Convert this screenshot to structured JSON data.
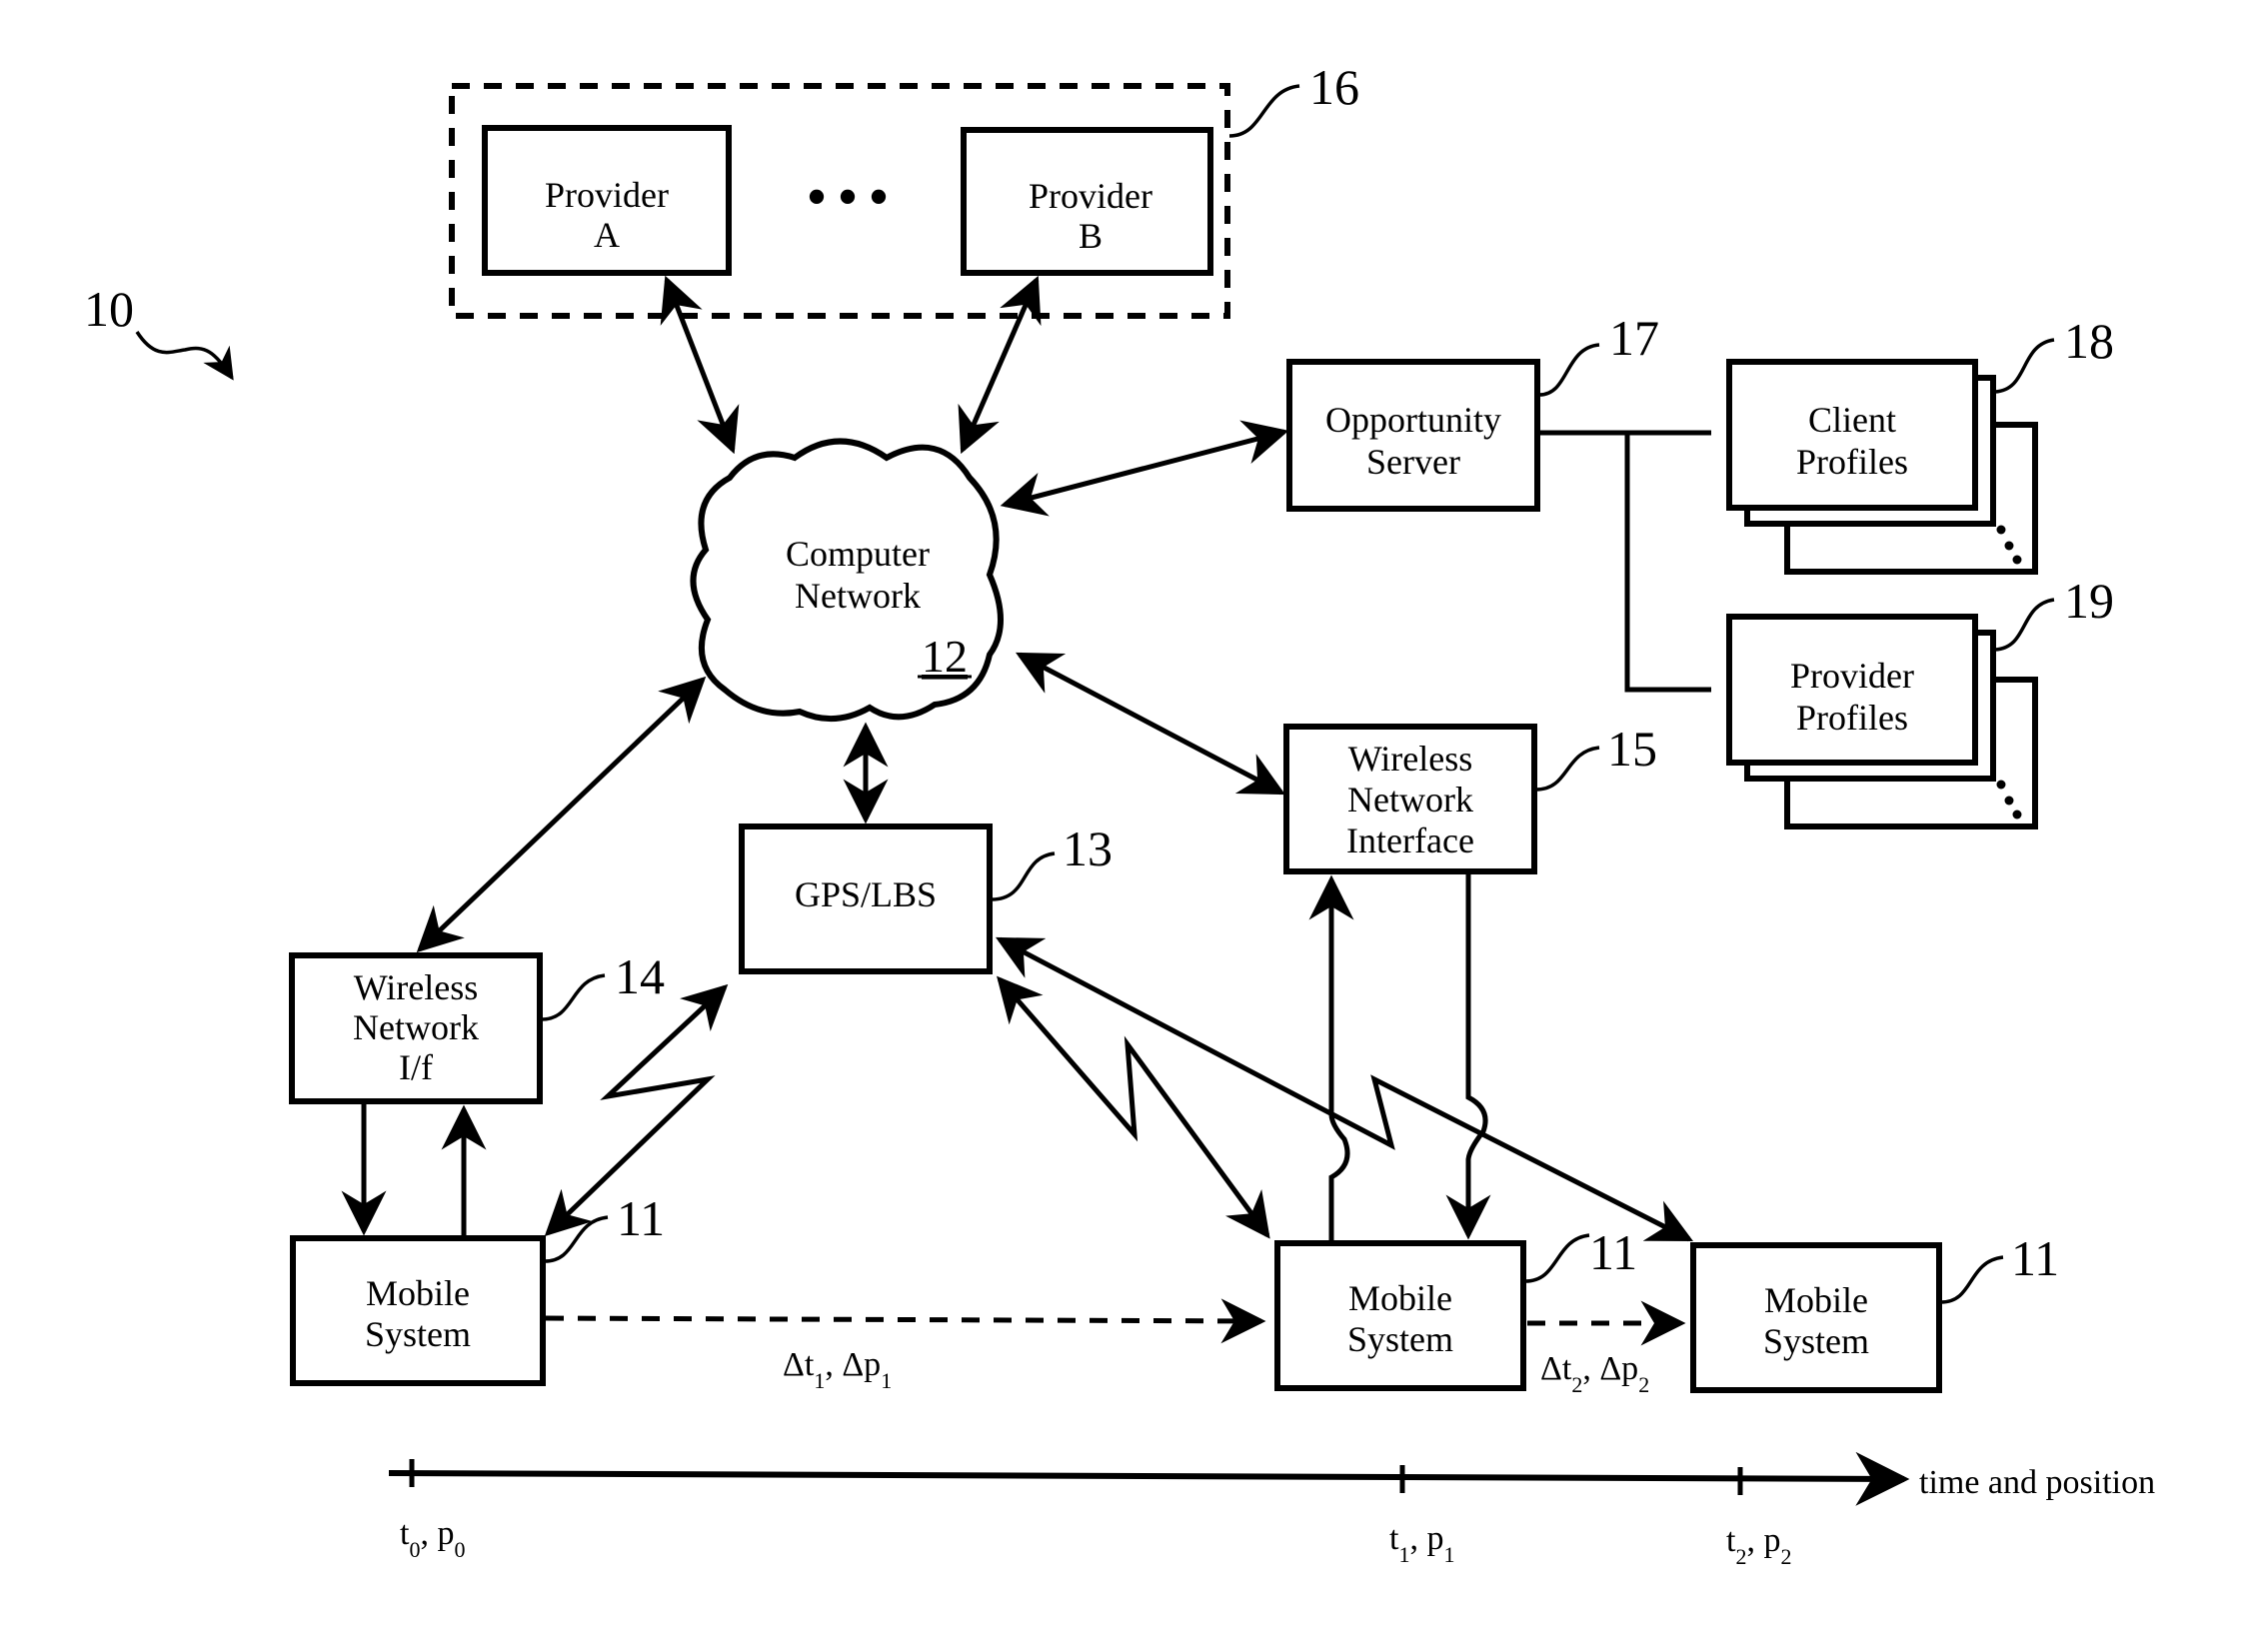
{
  "figure": {
    "reference": "10",
    "colors": {
      "ink": "#000000",
      "paper": "#ffffff"
    }
  },
  "providers_group": {
    "reference": "16",
    "provider_a": [
      "Provider",
      "A"
    ],
    "provider_b": [
      "Provider",
      "B"
    ],
    "ellipsis": "•••"
  },
  "computer_network": {
    "label": [
      "Computer",
      "Network"
    ],
    "reference": "12"
  },
  "opportunity_server": {
    "label": [
      "Opportunity",
      "Server"
    ],
    "reference": "17"
  },
  "client_profiles": {
    "label": [
      "Client",
      "Profiles"
    ],
    "reference": "18"
  },
  "provider_profiles": {
    "label": [
      "Provider",
      "Profiles"
    ],
    "reference": "19"
  },
  "gps_lbs": {
    "label": "GPS/LBS",
    "reference": "13"
  },
  "wireless_if_left": {
    "label": [
      "Wireless",
      "Network",
      "I/f"
    ],
    "reference": "14"
  },
  "wireless_if_right": {
    "label": [
      "Wireless",
      "Network",
      "Interface"
    ],
    "reference": "15"
  },
  "mobile_systems": [
    {
      "label": [
        "Mobile",
        "System"
      ],
      "reference": "11"
    },
    {
      "label": [
        "Mobile",
        "System"
      ],
      "reference": "11"
    },
    {
      "label": [
        "Mobile",
        "System"
      ],
      "reference": "11"
    }
  ],
  "transitions": [
    {
      "delta_t": "Δt",
      "t_sub": "1",
      "delta_p": "Δp",
      "p_sub": "1"
    },
    {
      "delta_t": "Δt",
      "t_sub": "2",
      "delta_p": "Δp",
      "p_sub": "2"
    }
  ],
  "timeline": {
    "axis_label": "time and position",
    "ticks": [
      {
        "t": "t",
        "t_sub": "0",
        "p": "p",
        "p_sub": "0"
      },
      {
        "t": "t",
        "t_sub": "1",
        "p": "p",
        "p_sub": "1"
      },
      {
        "t": "t",
        "t_sub": "2",
        "p": "p",
        "p_sub": "2"
      }
    ]
  }
}
